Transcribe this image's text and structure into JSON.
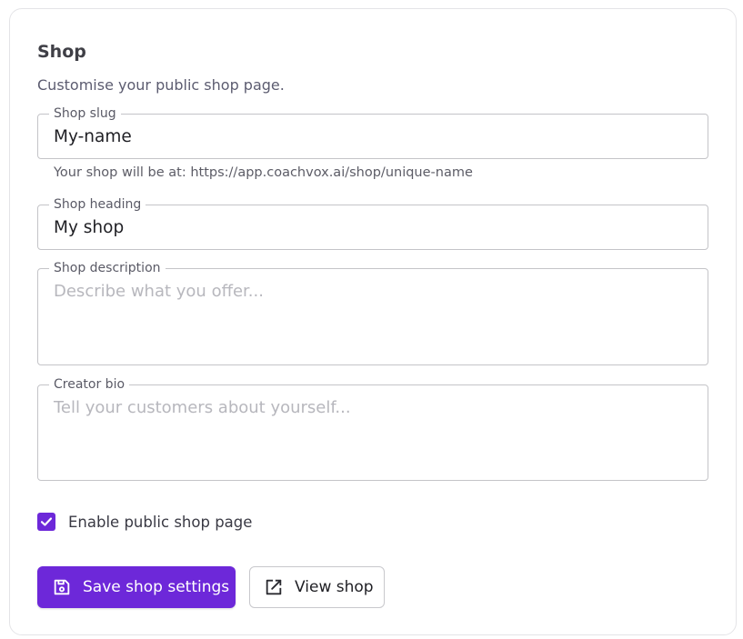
{
  "shop": {
    "title": "Shop",
    "subtitle": "Customise your public shop page.",
    "slug": {
      "label": "Shop slug",
      "value": "My-name",
      "helper": "Your shop will be at: https://app.coachvox.ai/shop/unique-name"
    },
    "heading": {
      "label": "Shop heading",
      "value": "My shop"
    },
    "description": {
      "label": "Shop description",
      "placeholder": "Describe what you offer..."
    },
    "bio": {
      "label": "Creator bio",
      "placeholder": "Tell your customers about yourself..."
    },
    "enable": {
      "label": "Enable public shop page",
      "checked": true
    },
    "save_label": "Save shop settings",
    "view_label": "View shop"
  },
  "colors": {
    "accent": "#6d28d9"
  },
  "icons": {
    "save": "floppy-disk-icon",
    "view": "external-link-icon",
    "check": "checkmark-icon"
  }
}
